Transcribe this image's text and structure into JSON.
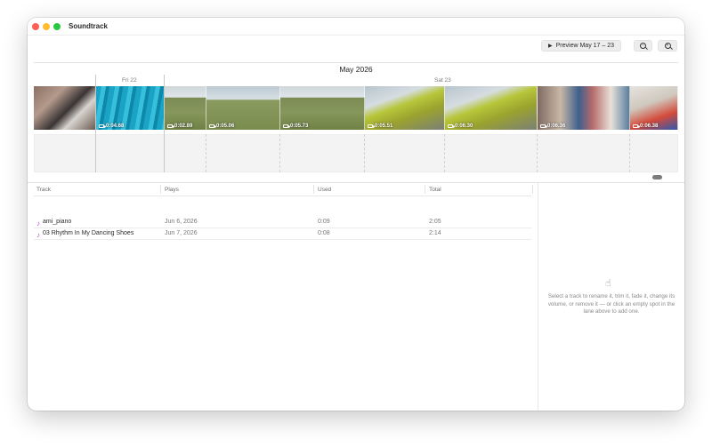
{
  "window": {
    "title": "Soundtrack"
  },
  "toolbar": {
    "preview_label": "Preview May 17 – 23",
    "zoom_out_icon": "zoom-out-icon",
    "zoom_in_icon": "zoom-in-icon"
  },
  "timeline": {
    "month": "May 2026",
    "days": [
      "Fri 22",
      "Sat 23"
    ],
    "clips": [
      {
        "duration": "",
        "thumb": "piano"
      },
      {
        "duration": "0:04.68",
        "thumb": "pool"
      },
      {
        "duration": "0:02.89",
        "thumb": "field"
      },
      {
        "duration": "0:05.06",
        "thumb": "field2"
      },
      {
        "duration": "0:05.73",
        "thumb": "field"
      },
      {
        "duration": "0:05.51",
        "thumb": "slide"
      },
      {
        "duration": "0:06.30",
        "thumb": "slide"
      },
      {
        "duration": "0:06.36",
        "thumb": "gym"
      },
      {
        "duration": "0:06.38",
        "thumb": "gym2"
      }
    ]
  },
  "table": {
    "headers": {
      "track": "Track",
      "plays": "Plays",
      "used": "Used",
      "total": "Total"
    },
    "rows": [
      {
        "track": "ami_piano",
        "plays": "Jun 6, 2026",
        "used": "0:09",
        "total": "2:05"
      },
      {
        "track": "03 Rhythm In My Dancing Shoes",
        "plays": "Jun 7, 2026",
        "used": "0:08",
        "total": "2:14"
      }
    ]
  },
  "sidebar": {
    "hint": "Select a track to rename it, trim it, fade it, change its volume, or remove it — or click an empty spot in the lane above to add one."
  },
  "colors": {
    "note_icon": "#b54ad6",
    "close": "#fe5f57",
    "minimize": "#febc2e",
    "zoom": "#28c840"
  }
}
